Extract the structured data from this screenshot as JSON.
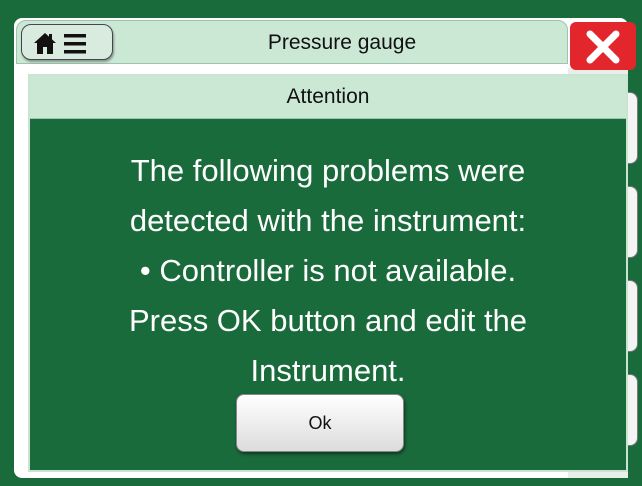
{
  "window": {
    "title": "Pressure gauge"
  },
  "dialog": {
    "title": "Attention",
    "message_lines": [
      "The following problems were",
      "detected with the instrument:",
      "• Controller is not available.",
      "Press OK button and edit the",
      "Instrument."
    ],
    "ok_label": "Ok"
  },
  "icons": {
    "home": "home-icon",
    "menu": "hamburger-menu-icon",
    "close": "close-icon"
  },
  "colors": {
    "background": "#1a6b3c",
    "header_bg": "#cbe8d5",
    "close_bg": "#e2262c",
    "text_on_dialog": "#ffffff"
  }
}
